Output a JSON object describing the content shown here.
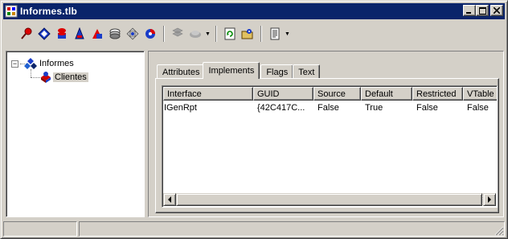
{
  "window": {
    "title": "Informes.tlb",
    "title_icon": "typelib-icon",
    "buttons": [
      "minimize",
      "maximize",
      "close"
    ]
  },
  "toolbar": {
    "icons": [
      "red-pin-icon",
      "blue-diamond-icon",
      "red-stack-icon",
      "blue-cone-icon",
      "red-blue-shapes-icon",
      "grey-stack-icon",
      "blue-arrows-icon",
      "blue-red-disc-icon",
      "grey-stack-disabled-icon",
      "grey-component-disabled-icon",
      "green-refresh-icon",
      "open-folder-gear-icon",
      "document-view-icon"
    ]
  },
  "tree": {
    "root": {
      "label": "Informes",
      "expander": "−"
    },
    "children": [
      {
        "label": "Clientes",
        "selected": true
      }
    ]
  },
  "tabs": [
    {
      "label": "Attributes",
      "active": false
    },
    {
      "label": "Implements",
      "active": true
    },
    {
      "label": "Flags",
      "active": false
    },
    {
      "label": "Text",
      "active": false
    }
  ],
  "listview": {
    "columns": [
      "Interface",
      "GUID",
      "Source",
      "Default",
      "Restricted",
      "VTable"
    ],
    "rows": [
      [
        "IGenRpt",
        "{42C417C...",
        "False",
        "True",
        "False",
        "False"
      ]
    ]
  },
  "colors": {
    "titlebar": "#0a246a",
    "face": "#d4d0c8"
  }
}
